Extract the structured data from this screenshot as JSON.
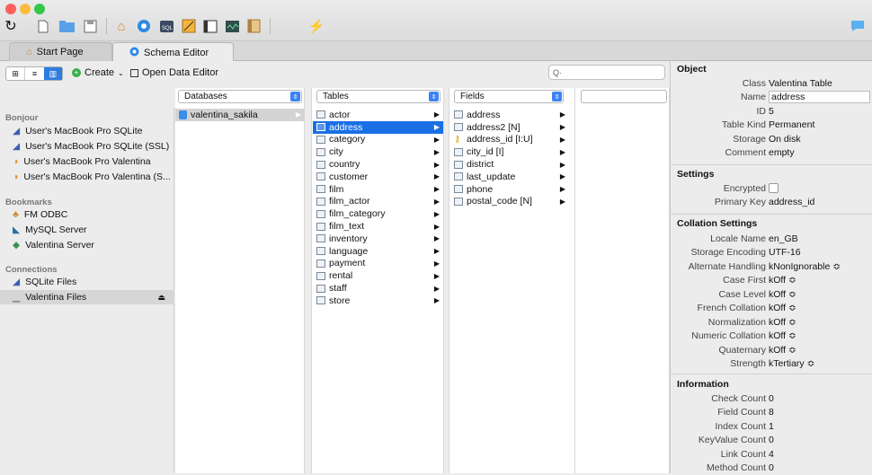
{
  "tabs": [
    {
      "label": "Start Page"
    },
    {
      "label": "Schema Editor"
    }
  ],
  "toolbar": {
    "create_label": "Create",
    "open_editor_label": "Open Data Editor",
    "search_placeholder": "Q·"
  },
  "headers": {
    "databases": "Databases",
    "tables": "Tables",
    "fields": "Fields"
  },
  "sidebar": {
    "bonjour": "Bonjour",
    "bonjour_items": [
      "User's MacBook Pro SQLite",
      "User's MacBook Pro SQLite (SSL)",
      "User's MacBook Pro Valentina",
      "User's MacBook Pro Valentina (S..."
    ],
    "bookmarks": "Bookmarks",
    "bookmark_items": [
      "FM ODBC",
      "MySQL Server",
      "Valentina Server"
    ],
    "connections": "Connections",
    "connection_items": [
      "SQLite Files",
      "Valentina Files"
    ]
  },
  "databases": [
    "valentina_sakila"
  ],
  "tables": [
    "actor",
    "address",
    "category",
    "city",
    "country",
    "customer",
    "film",
    "film_actor",
    "film_category",
    "film_text",
    "inventory",
    "language",
    "payment",
    "rental",
    "staff",
    "store"
  ],
  "fields": [
    "address",
    "address2 [N]",
    "address_id [I:U]",
    "city_id [I]",
    "district",
    "last_update",
    "phone",
    "postal_code [N]"
  ],
  "object": {
    "title": "Object",
    "class_k": "Class",
    "class_v": "Valentina Table",
    "name_k": "Name",
    "name_v": "address",
    "id_k": "ID",
    "id_v": "5",
    "kind_k": "Table Kind",
    "kind_v": "Permanent",
    "storage_k": "Storage",
    "storage_v": "On disk",
    "comment_k": "Comment",
    "comment_v": "empty"
  },
  "settings": {
    "title": "Settings",
    "enc_k": "Encrypted",
    "pk_k": "Primary Key",
    "pk_v": "address_id"
  },
  "collation": {
    "title": "Collation Settings",
    "rows": [
      [
        "Locale Name",
        "en_GB"
      ],
      [
        "Storage Encoding",
        "UTF-16"
      ],
      [
        "Alternate Handling",
        "kNonIgnorable ≎"
      ],
      [
        "Case First",
        "kOff ≎"
      ],
      [
        "Case Level",
        "kOff ≎"
      ],
      [
        "French Collation",
        "kOff ≎"
      ],
      [
        "Normalization",
        "kOff ≎"
      ],
      [
        "Numeric Collation",
        "kOff ≎"
      ],
      [
        "Quaternary",
        "kOff ≎"
      ],
      [
        "Strength",
        "kTertiary ≎"
      ]
    ]
  },
  "info": {
    "title": "Information",
    "rows": [
      [
        "Check Count",
        "0"
      ],
      [
        "Field Count",
        "8"
      ],
      [
        "Index Count",
        "1"
      ],
      [
        "KeyValue Count",
        "0"
      ],
      [
        "Link Count",
        "4"
      ],
      [
        "Method Count",
        "0"
      ]
    ]
  }
}
